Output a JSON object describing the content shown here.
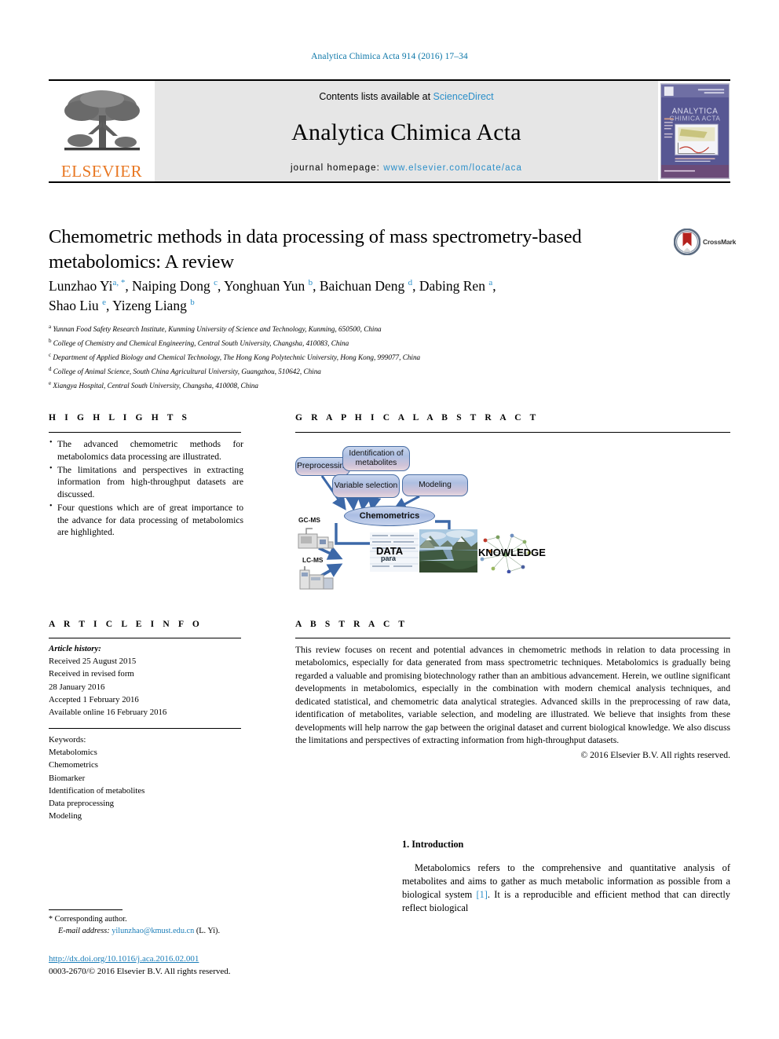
{
  "running_head": "Analytica Chimica Acta 914 (2016) 17–34",
  "journal_header": {
    "publisher": "ELSEVIER",
    "contents_prefix": "Contents lists available at ",
    "contents_link": "ScienceDirect",
    "journal_title": "Analytica Chimica Acta",
    "homepage_prefix": "journal homepage: ",
    "homepage_url": "www.elsevier.com/locate/aca",
    "cover_title_line1": "ANALYTICA",
    "cover_title_line2": "CHIMICA ACTA"
  },
  "article": {
    "title": "Chemometric methods in data processing of mass spectrometry-based metabolomics: A review",
    "crossmark_label": "CrossMark",
    "authors_line1": "Lunzhao Yi",
    "authors_html": "Lunzhao Yi a, *, Naiping Dong c, Yonghuan Yun b, Baichuan Deng d, Dabing Ren a, Shao Liu e, Yizeng Liang b",
    "authors": [
      {
        "name": "Lunzhao Yi",
        "marks": "a, *"
      },
      {
        "name": "Naiping Dong",
        "marks": "c"
      },
      {
        "name": "Yonghuan Yun",
        "marks": "b"
      },
      {
        "name": "Baichuan Deng",
        "marks": "d"
      },
      {
        "name": "Dabing Ren",
        "marks": "a"
      },
      {
        "name": "Shao Liu",
        "marks": "e"
      },
      {
        "name": "Yizeng Liang",
        "marks": "b"
      }
    ],
    "affiliations": [
      {
        "mark": "a",
        "text": "Yunnan Food Safety Research Institute, Kunming University of Science and Technology, Kunming, 650500, China"
      },
      {
        "mark": "b",
        "text": "College of Chemistry and Chemical Engineering, Central South University, Changsha, 410083, China"
      },
      {
        "mark": "c",
        "text": "Department of Applied Biology and Chemical Technology, The Hong Kong Polytechnic University, Hong Kong, 999077, China"
      },
      {
        "mark": "d",
        "text": "College of Animal Science, South China Agricultural University, Guangzhou, 510642, China"
      },
      {
        "mark": "e",
        "text": "Xiangya Hospital, Central South University, Changsha, 410008, China"
      }
    ]
  },
  "highlights": {
    "heading": "H I G H L I G H T S",
    "items": [
      "The advanced chemometric methods for metabolomics data processing are illustrated.",
      "The limitations and perspectives in extracting information from high-throughput datasets are discussed.",
      "Four questions which are of great importance to the advance for data processing of metabolomics are highlighted."
    ]
  },
  "graphical_abstract": {
    "heading": "G R A P H I C A L   A B S T R A C T",
    "nodes": [
      {
        "id": "preprocessing",
        "label": "Preprocessing"
      },
      {
        "id": "identification",
        "label": "Identification of metabolites"
      },
      {
        "id": "variable-selection",
        "label": "Variable selection"
      },
      {
        "id": "modeling",
        "label": "Modeling"
      },
      {
        "id": "chemometrics",
        "label": "Chemometrics"
      }
    ],
    "instrument_labels": [
      "GC-MS",
      "LC-MS"
    ],
    "flow_labels": [
      "DATA",
      "KNOWLEDGE"
    ]
  },
  "article_info": {
    "heading": "A R T I C L E   I N F O",
    "history_label": "Article history:",
    "history": [
      "Received 25 August 2015",
      "Received in revised form",
      "28 January 2016",
      "Accepted 1 February 2016",
      "Available online 16 February 2016"
    ],
    "keywords_label": "Keywords:",
    "keywords": [
      "Metabolomics",
      "Chemometrics",
      "Biomarker",
      "Identification of metabolites",
      "Data preprocessing",
      "Modeling"
    ]
  },
  "abstract": {
    "heading": "A B S T R A C T",
    "text": "This review focuses on recent and potential advances in chemometric methods in relation to data processing in metabolomics, especially for data generated from mass spectrometric techniques. Metabolomics is gradually being regarded a valuable and promising biotechnology rather than an ambitious advancement. Herein, we outline significant developments in metabolomics, especially in the combination with modern chemical analysis techniques, and dedicated statistical, and chemometric data analytical strategies. Advanced skills in the preprocessing of raw data, identification of metabolites, variable selection, and modeling are illustrated. We believe that insights from these developments will help narrow the gap between the original dataset and current biological knowledge. We also discuss the limitations and perspectives of extracting information from high-throughput datasets.",
    "copyright": "© 2016 Elsevier B.V. All rights reserved."
  },
  "introduction": {
    "heading": "1.  Introduction",
    "paragraph_part1": "Metabolomics refers to the comprehensive and quantitative analysis of metabolites and aims to gather as much metabolic information as possible from a biological system ",
    "citation": "[1]",
    "paragraph_part2": ". It is a reproducible and efficient method that can directly reflect biological"
  },
  "footer": {
    "corresponding_star": "*",
    "corresponding_label": "Corresponding author.",
    "email_label": "E-mail address:",
    "email": "yilunzhao@kmust.edu.cn",
    "email_owner": "(L. Yi).",
    "doi": "http://dx.doi.org/10.1016/j.aca.2016.02.001",
    "issn_line": "0003-2670/© 2016 Elsevier B.V. All rights reserved."
  },
  "colors": {
    "link_blue": "#2b8fc9",
    "running_head_blue": "#0b76a8",
    "elsevier_orange": "#e87722",
    "header_band_gray": "#e6e6e6"
  }
}
